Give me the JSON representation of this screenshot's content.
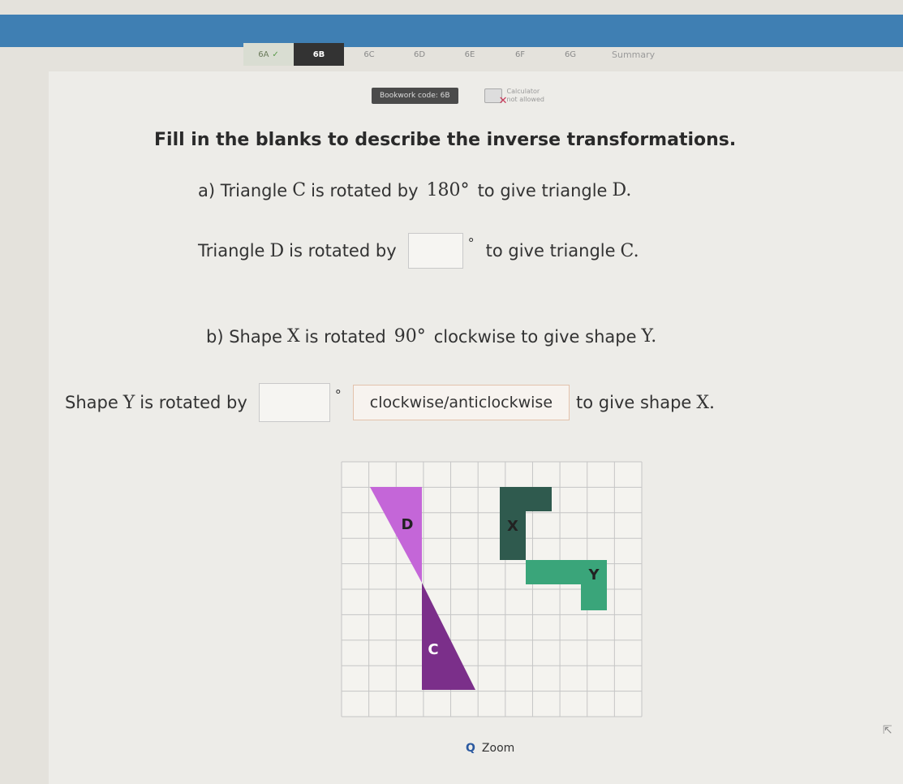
{
  "tabs": [
    {
      "label": "6A",
      "state": "done"
    },
    {
      "label": "6B",
      "state": "active"
    },
    {
      "label": "6C",
      "state": "todo"
    },
    {
      "label": "6D",
      "state": "todo"
    },
    {
      "label": "6E",
      "state": "todo"
    },
    {
      "label": "6F",
      "state": "todo"
    },
    {
      "label": "6G",
      "state": "todo"
    }
  ],
  "summary_label": "Summary",
  "toolbar": {
    "bookwork": "Bookwork code: 6B",
    "calculator_line1": "Calculator",
    "calculator_line2": "not allowed"
  },
  "question": {
    "title": "Fill in the blanks to describe the inverse transformations.",
    "part_a": {
      "line1_prefix": "a) Triangle",
      "line1_var": "C",
      "line1_mid": "is rotated by",
      "line1_value": "180°",
      "line1_mid2": "to give triangle",
      "line1_var2": "D.",
      "line2_prefix": "Triangle",
      "line2_var": "D",
      "line2_mid": "is rotated by",
      "line2_deg": "°",
      "line2_suffix": "to give triangle",
      "line2_var2": "C."
    },
    "part_b": {
      "line1_prefix": "b) Shape",
      "line1_var": "X",
      "line1_mid": "is rotated",
      "line1_value": "90°",
      "line1_suffix": "clockwise to give shape",
      "line1_var2": "Y.",
      "line2_prefix": "Shape",
      "line2_var": "Y",
      "line2_mid": "is rotated by",
      "line2_deg": "°",
      "toggle_label": "clockwise/anticlockwise",
      "line2_suffix": "to give shape",
      "line2_var2": "X."
    }
  },
  "diagram": {
    "labels": {
      "D": "D",
      "C": "C",
      "X": "X",
      "Y": "Y"
    },
    "colors": {
      "D": "#c466d8",
      "C": "#7b2f8a",
      "X": "#2f5a4e",
      "Y": "#3aa57a",
      "grid": "#c5c5c5"
    }
  },
  "zoom_label": "Zoom"
}
